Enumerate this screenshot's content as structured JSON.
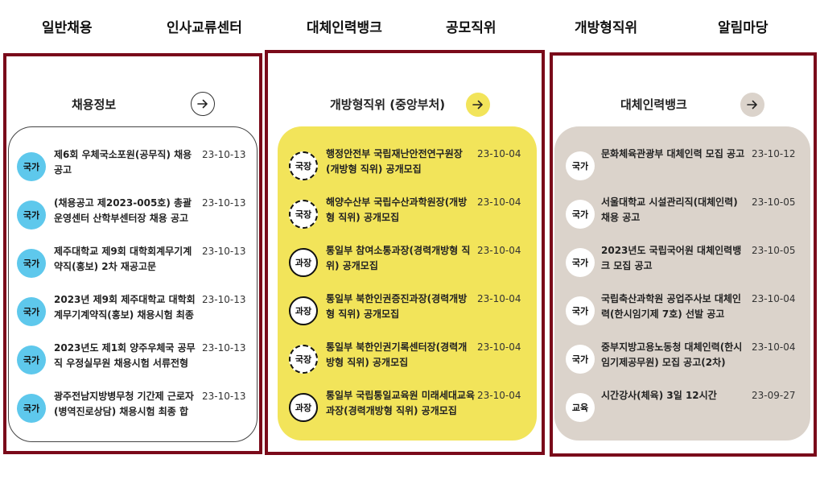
{
  "nav": [
    "일반채용",
    "인사교류센터",
    "대체인력뱅크",
    "공모직위",
    "개방형직위",
    "알림마당"
  ],
  "colors": {
    "frame": "#7a0a1a",
    "yellow": "#f2e45a",
    "beige": "#dbd3cb",
    "cyan": "#5ec8ec"
  },
  "panels": [
    {
      "title": "채용정보",
      "arrow_icon": "arrow-right-icon",
      "items": [
        {
          "badge": "국가",
          "title": "제6회 우체국소포원(공무직) 채용 공고",
          "date": "23-10-13"
        },
        {
          "badge": "국가",
          "title": "(채용공고 제2023-005호) 총괄운영센터 산학부센터장 채용 공고",
          "date": "23-10-13"
        },
        {
          "badge": "국가",
          "title": "제주대학교 제9회 대학회계무기계약직(홍보) 2차 재공고문",
          "date": "23-10-13"
        },
        {
          "badge": "국가",
          "title": "2023년 제9회 제주대학교 대학회계무기계약직(홍보) 채용시험 최종",
          "date": "23-10-13"
        },
        {
          "badge": "국가",
          "title": "2023년도 제1회 양주우체국 공무직 우정실무원 채용시험 서류전형",
          "date": "23-10-13"
        },
        {
          "badge": "국가",
          "title": "광주전남지방병무청 기간제 근로자(병역진로상담) 채용시험 최종 합격",
          "date": "23-10-13"
        }
      ]
    },
    {
      "title": "개방형직위 (중앙부처)",
      "arrow_icon": "arrow-right-icon",
      "items": [
        {
          "badge": "국장",
          "style": "dashed",
          "title": "행정안전부 국립재난안전연구원장(개방형 직위) 공개모집",
          "date": "23-10-04"
        },
        {
          "badge": "국장",
          "style": "dashed",
          "title": "해양수산부 국립수산과학원장(개방형 직위) 공개모집",
          "date": "23-10-04"
        },
        {
          "badge": "과장",
          "style": "solid",
          "title": "통일부 참여소통과장(경력개방형 직위) 공개모집",
          "date": "23-10-04"
        },
        {
          "badge": "과장",
          "style": "solid",
          "title": "통일부 북한인권증진과장(경력개방형 직위) 공개모집",
          "date": "23-10-04"
        },
        {
          "badge": "국장",
          "style": "dashed",
          "title": "통일부 북한인권기록센터장(경력개방형 직위) 공개모집",
          "date": "23-10-04"
        },
        {
          "badge": "과장",
          "style": "solid",
          "title": "통일부 국립통일교육원 미래세대교육과장(경력개방형 직위) 공개모집",
          "date": "23-10-04"
        }
      ]
    },
    {
      "title": "대체인력뱅크",
      "arrow_icon": "arrow-right-icon",
      "items": [
        {
          "badge": "국가",
          "title": "문화체육관광부 대체인력 모집 공고",
          "date": "23-10-12"
        },
        {
          "badge": "국가",
          "title": "서울대학교 시설관리직(대체인력) 채용 공고",
          "date": "23-10-05"
        },
        {
          "badge": "국가",
          "title": "2023년도 국립국어원 대체인력뱅크 모집 공고",
          "date": "23-10-05"
        },
        {
          "badge": "국가",
          "title": "국립축산과학원 공업주사보 대체인력(한시임기제 7호) 선발 공고",
          "date": "23-10-04"
        },
        {
          "badge": "국가",
          "title": "중부지방고용노동청 대체인력(한시임기제공무원) 모집 공고(2차)",
          "date": "23-10-04"
        },
        {
          "badge": "교육",
          "title": "시간강사(체육) 3일 12시간",
          "date": "23-09-27"
        }
      ]
    }
  ]
}
